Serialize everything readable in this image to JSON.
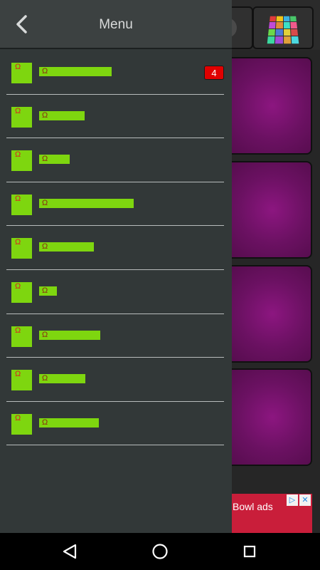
{
  "drawer": {
    "title": "Menu",
    "items": [
      {
        "glyph": "Ω",
        "label_text": "",
        "label_width": 102,
        "badge": "4"
      },
      {
        "glyph": "Ω",
        "label_text": "",
        "label_width": 64
      },
      {
        "glyph": "Ω",
        "label_text": "",
        "label_width": 43
      },
      {
        "glyph": "Ω",
        "label_text": "",
        "label_width": 133
      },
      {
        "glyph": "Ω",
        "label_text": "",
        "label_width": 77
      },
      {
        "glyph": "Ω",
        "label_text": "",
        "label_width": 25
      },
      {
        "glyph": "Ω",
        "label_text": "",
        "label_width": 86
      },
      {
        "glyph": "Ω",
        "label_text": "",
        "label_width": 65
      },
      {
        "glyph": "Ω",
        "label_text": "",
        "label_width": 84
      }
    ]
  },
  "background": {
    "ad_text": "Bowl ads",
    "ad_icons": [
      "adchoices-icon",
      "close-icon"
    ]
  },
  "colors": {
    "accent_green": "#7ed60f",
    "badge_red": "#e00000",
    "pad_purple": "#8c1680",
    "drawer_bg": "#323838",
    "header_bg": "#3c4141"
  },
  "icons": {
    "back": "chevron-left-icon",
    "nav_back": "triangle-back-icon",
    "nav_home": "circle-home-icon",
    "nav_recents": "square-recents-icon"
  }
}
